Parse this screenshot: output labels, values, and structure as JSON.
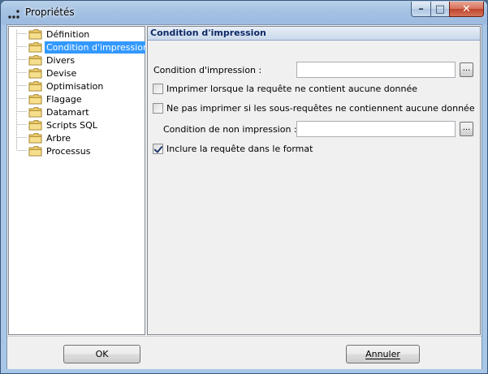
{
  "window": {
    "title": "Propriétés"
  },
  "caption_buttons": {
    "minimize": "–",
    "maximize": "□",
    "close": "✕"
  },
  "tree": {
    "items": [
      {
        "label": "Définition",
        "selected": false
      },
      {
        "label": "Condition d'impression",
        "selected": true
      },
      {
        "label": "Divers",
        "selected": false
      },
      {
        "label": "Devise",
        "selected": false
      },
      {
        "label": "Optimisation",
        "selected": false
      },
      {
        "label": "Flagage",
        "selected": false
      },
      {
        "label": "Datamart",
        "selected": false
      },
      {
        "label": "Scripts SQL",
        "selected": false
      },
      {
        "label": "Arbre",
        "selected": false
      },
      {
        "label": "Processus",
        "selected": false
      }
    ]
  },
  "panel": {
    "title": "Condition d'impression",
    "condition_label": "Condition d'impression :",
    "condition_value": "",
    "browse_label": "...",
    "chk_empty": {
      "label": "Imprimer lorsque la requête ne contient aucune donnée",
      "checked": false
    },
    "chk_subqueries": {
      "label": "Ne pas imprimer si les sous-requêtes ne contiennent aucune donnée",
      "checked": false
    },
    "non_print_label": "Condition de non impression :",
    "non_print_value": "",
    "chk_include": {
      "label": "Inclure la requête dans le format",
      "checked": true
    }
  },
  "footer": {
    "ok_label": "OK",
    "cancel_label": "Annuler"
  },
  "colors": {
    "selection": "#3399ff",
    "header_text": "#0d2a66"
  },
  "icons": {
    "tree_item": "folder-icon",
    "app": "app-icon"
  }
}
